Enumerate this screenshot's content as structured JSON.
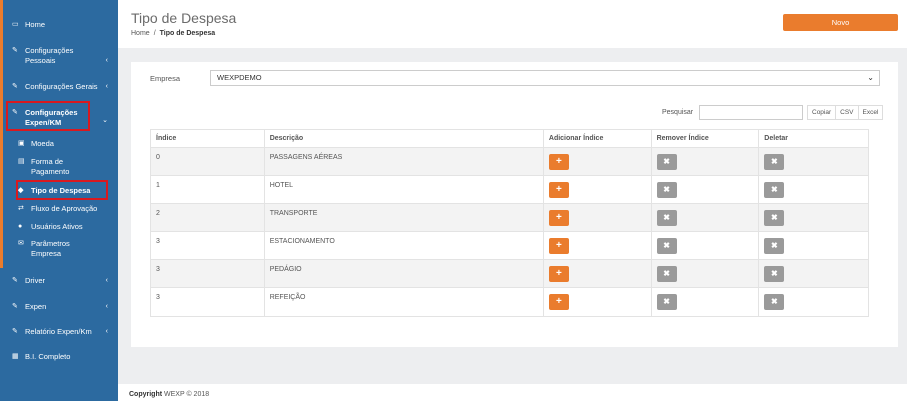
{
  "sidebar": {
    "items": [
      {
        "icon": "monitor-icon",
        "glyph": "▭",
        "label": "Home"
      },
      {
        "icon": "edit-icon",
        "glyph": "✎",
        "label": "Configurações Pessoais",
        "chevron": "‹"
      },
      {
        "icon": "edit-icon",
        "glyph": "✎",
        "label": "Configurações Gerais",
        "chevron": "‹"
      },
      {
        "icon": "edit-icon",
        "glyph": "✎",
        "label": "Configurações Expen/KM",
        "chevron": "⌄"
      },
      {
        "icon": "edit-icon",
        "glyph": "✎",
        "label": "Driver",
        "chevron": "‹"
      },
      {
        "icon": "edit-icon",
        "glyph": "✎",
        "label": "Expen",
        "chevron": "‹"
      },
      {
        "icon": "edit-icon",
        "glyph": "✎",
        "label": "Relatório Expen/Km",
        "chevron": "‹"
      },
      {
        "icon": "grid-icon",
        "glyph": "▦",
        "label": "B.I. Completo"
      }
    ],
    "subitems": [
      {
        "icon": "money-icon",
        "glyph": "▣",
        "label": "Moeda"
      },
      {
        "icon": "card-icon",
        "glyph": "▤",
        "label": "Forma de Pagamento"
      },
      {
        "icon": "tag-icon",
        "glyph": "◆",
        "label": "Tipo de Despesa"
      },
      {
        "icon": "retweet-icon",
        "glyph": "⇄",
        "label": "Fluxo de Aprovação"
      },
      {
        "icon": "user-icon",
        "glyph": "●",
        "label": "Usuários Ativos"
      },
      {
        "icon": "envelope-icon",
        "glyph": "✉",
        "label": "Parâmetros Empresa"
      }
    ]
  },
  "header": {
    "title": "Tipo de Despesa",
    "breadcrumb_home": "Home",
    "breadcrumb_sep": "/",
    "breadcrumb_current": "Tipo de Despesa",
    "new_button": "Novo"
  },
  "filters": {
    "empresa_label": "Empresa",
    "empresa_value": "WEXPDEMO",
    "search_label": "Pesquisar",
    "export_buttons": [
      "Copiar",
      "CSV",
      "Excel"
    ]
  },
  "table": {
    "columns": [
      "Índice",
      "Descrição",
      "Adicionar Índice",
      "Remover Índice",
      "Deletar"
    ],
    "rows": [
      {
        "indice": "0",
        "descricao": "PASSAGENS AÉREAS"
      },
      {
        "indice": "1",
        "descricao": "HOTEL"
      },
      {
        "indice": "2",
        "descricao": "TRANSPORTE"
      },
      {
        "indice": "3",
        "descricao": "ESTACIONAMENTO"
      },
      {
        "indice": "3",
        "descricao": "PEDÁGIO"
      },
      {
        "indice": "3",
        "descricao": "REFEIÇÃO"
      }
    ],
    "add_glyph": "+",
    "remove_glyph": "✖"
  },
  "footer": {
    "copyright_bold": "Copyright",
    "copyright_text": "WEXP © 2018"
  },
  "colors": {
    "sidebar": "#2c6aa0",
    "accent": "#ea7c2d",
    "highlight": "#d9191f",
    "grey_button": "#9a9a9a"
  }
}
